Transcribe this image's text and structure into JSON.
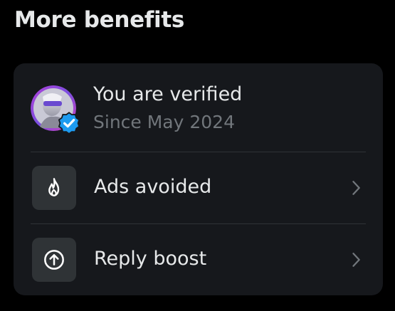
{
  "section": {
    "title": "More benefits"
  },
  "verified": {
    "title": "You are verified",
    "subtitle": "Since May 2024",
    "avatar_icon": "user-avatar",
    "badge_icon": "verified-badge-icon",
    "badge_color": "#1d9bf0"
  },
  "benefits": [
    {
      "label": "Ads avoided",
      "icon": "flame-icon"
    },
    {
      "label": "Reply boost",
      "icon": "arrow-up-circle-icon"
    }
  ],
  "colors": {
    "background": "#000000",
    "card": "#16181c",
    "icon_box": "#2f3336",
    "primary_text": "#e7e9ea",
    "secondary_text": "#71767b",
    "divider": "#2f3336"
  }
}
